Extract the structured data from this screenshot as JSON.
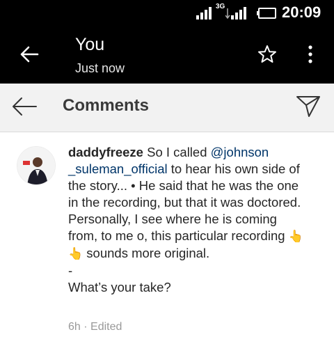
{
  "status_bar": {
    "network_type": "3G",
    "time": "20:09"
  },
  "app_bar": {
    "title": "You",
    "subtitle": "Just now"
  },
  "comments_header": {
    "title": "Comments"
  },
  "comment": {
    "username": "daddyfreeze",
    "segment_1": " So I called ",
    "mention": "@johnson _suleman_official",
    "segment_2": " to hear his own side of the story... • He said that he was the one in the recording, but that it was doctored. Personally, I see where he is coming from, to me o, this particular recording ",
    "emoji": "👆👆",
    "segment_3": " sounds more original.",
    "separator": "-",
    "question": "What’s your take?",
    "time": "6h",
    "edited": "Edited",
    "meta_separator": " · "
  },
  "colors": {
    "bar_background": "#000000",
    "header_background": "#f2f2f2",
    "mention": "#003569",
    "meta_text": "#999999"
  },
  "icons": [
    "back-arrow-icon",
    "star-icon",
    "more-vert-icon",
    "send-icon",
    "signal-icon",
    "battery-icon"
  ]
}
